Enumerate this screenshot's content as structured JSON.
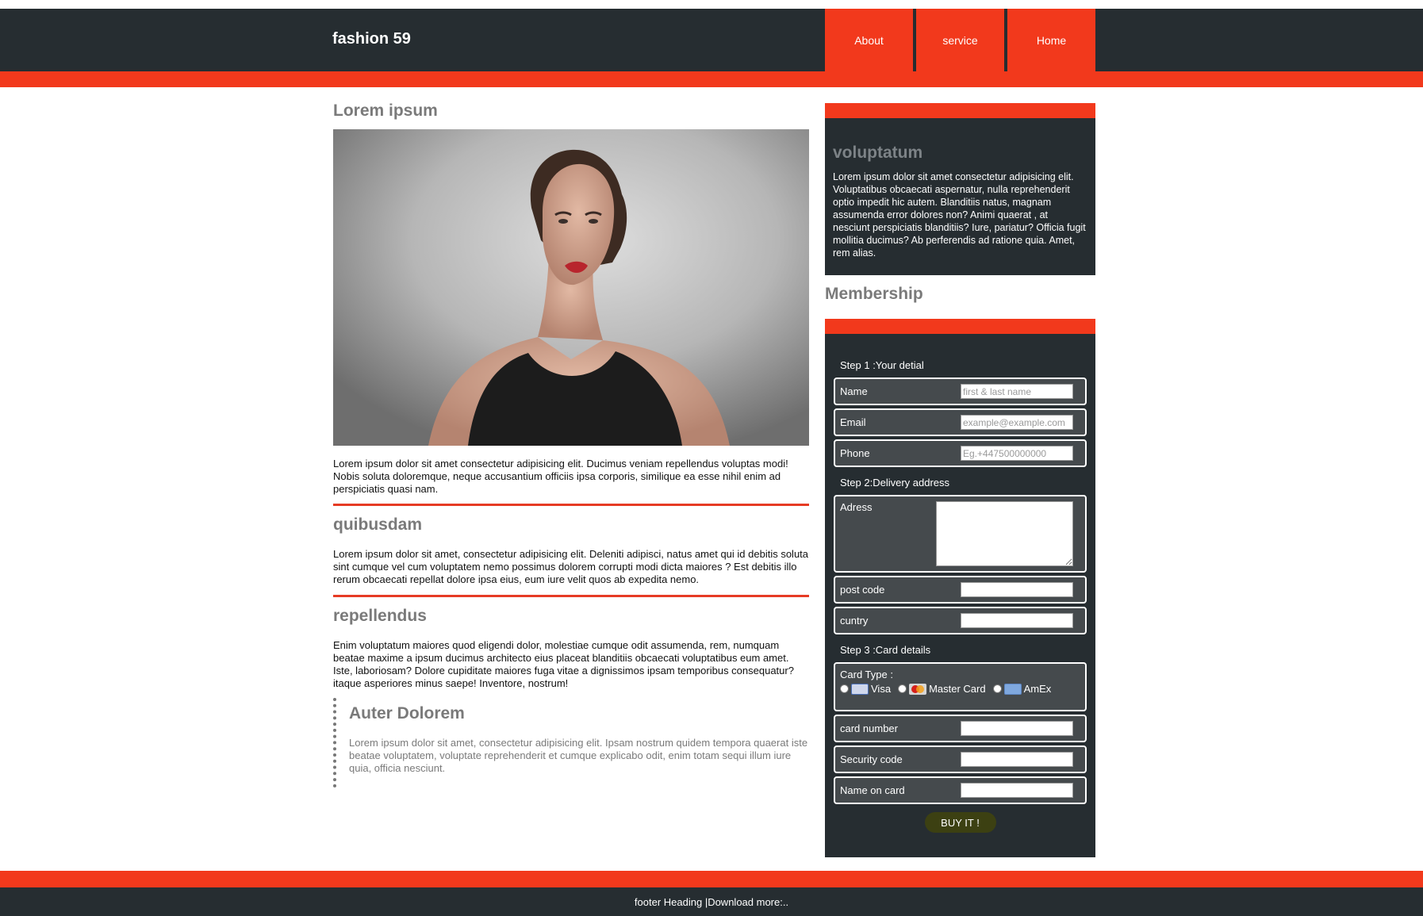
{
  "header": {
    "brand": "fashion 59",
    "nav": [
      {
        "label": "About"
      },
      {
        "label": "service"
      },
      {
        "label": "Home"
      }
    ]
  },
  "main": {
    "title": "Lorem ipsum",
    "intro": "Lorem ipsum dolor sit amet consectetur adipisicing elit. Ducimus veniam repellendus voluptas modi! Nobis soluta doloremque, neque accusantium officiis ipsa corporis, similique ea esse nihil enim ad perspiciatis quasi nam.",
    "section2_title": "quibusdam",
    "section2_text": "Lorem ipsum dolor sit amet, consectetur adipisicing elit. Deleniti adipisci, natus amet qui id debitis soluta sint cumque vel cum voluptatem nemo possimus dolorem corrupti modi dicta maiores ? Est debitis illo rerum obcaecati repellat dolore ipsa eius, eum iure velit quos ab expedita nemo.",
    "section3_title": "repellendus",
    "section3_text": "Enim voluptatum maiores quod eligendi dolor, molestiae cumque odit assumenda, rem, numquam beatae maxime a ipsum ducimus architecto eius placeat blanditiis obcaecati voluptatibus eum amet. Iste, laboriosam? Dolore cupiditate maiores fuga vitae a dignissimos ipsam temporibus consequatur? itaque asperiores minus saepe! Inventore, nostrum!",
    "quote_title": "Auter Dolorem",
    "quote_text": "Lorem ipsum dolor sit amet, consectetur adipisicing elit. Ipsam nostrum quidem tempora quaerat iste beatae voluptatem, voluptate reprehenderit et cumque explicabo odit, enim totam sequi illum iure quia, officia nesciunt."
  },
  "sidebar": {
    "panel_title": "voluptatum",
    "panel_text": "Lorem ipsum dolor sit amet consectetur adipisicing elit. Voluptatibus obcaecati aspernatur, nulla reprehenderit optio impedit hic autem. Blanditiis natus, magnam assumenda error dolores non? Animi quaerat , at nesciunt perspiciatis blanditiis? Iure, pariatur? Officia fugit mollitia ducimus? Ab perferendis ad ratione quia. Amet, rem alias.",
    "membership_title": "Membership"
  },
  "form": {
    "step1": "Step 1 :Your detial",
    "name_label": "Name",
    "name_placeholder": "first & last name",
    "email_label": "Email",
    "email_placeholder": "example@example.com",
    "phone_label": "Phone",
    "phone_placeholder": "Eg.+447500000000",
    "step2": "Step 2:Delivery address",
    "address_label": "Adress",
    "postcode_label": "post code",
    "country_label": "cuntry",
    "step3": "Step 3 :Card details",
    "card_type_label": "Card Type :",
    "card_options": [
      {
        "label": "Visa",
        "icon": "visa-card-icon"
      },
      {
        "label": "Master Card",
        "icon": "mastercard-icon"
      },
      {
        "label": "AmEx",
        "icon": "amex-card-icon"
      }
    ],
    "card_number_label": "card number",
    "security_code_label": "Security code",
    "name_on_card_label": "Name on card",
    "buy_label": "BUY IT !"
  },
  "footer": {
    "text": "footer Heading |Download more:.."
  },
  "colors": {
    "accent": "#f2391c",
    "dark": "#262d31",
    "button": "#3c4012"
  }
}
